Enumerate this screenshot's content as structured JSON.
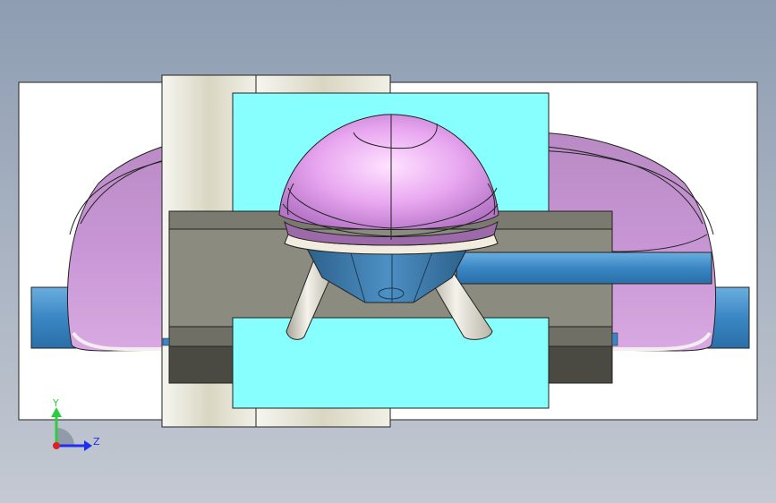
{
  "viewport": {
    "background_top": "#8e9db2",
    "background_bottom": "#c4c9d2"
  },
  "model": {
    "colors": {
      "plate_white": "#ffffff",
      "plate_cream": "#f2f2ea",
      "cavity_cyan": "#88ffff",
      "slider_gray": "#8b8b80",
      "slider_dark": "#4a4a42",
      "part_purple": "#c88fd0",
      "part_purple_light": "#efc0f5",
      "runner_blue": "#3a86c4",
      "pin_ivory": "#e8e5d8",
      "edge": "#222222"
    }
  },
  "triad": {
    "y_label": "Y",
    "z_label": "Z",
    "y_color": "#2ecc40",
    "z_color": "#1f2ff0",
    "x_color": "#e02020"
  }
}
